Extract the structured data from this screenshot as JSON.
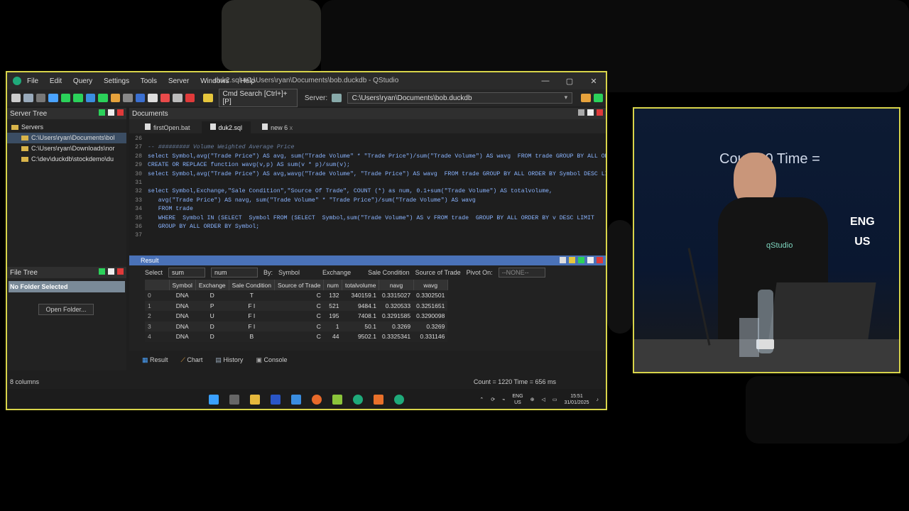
{
  "window": {
    "title": "duk2.sql #C:\\Users\\ryan\\Documents\\bob.duckdb - QStudio",
    "menu": [
      "File",
      "Edit",
      "Query",
      "Settings",
      "Tools",
      "Server",
      "Windows",
      "Help"
    ],
    "min": "—",
    "max": "▢",
    "close": "✕"
  },
  "toolbar": {
    "cmd_search": "Cmd Search [Ctrl+]+[P]",
    "server_label": "Server:",
    "server_value": "C:\\Users\\ryan\\Documents\\bob.duckdb"
  },
  "server_tree": {
    "title": "Server Tree",
    "root": "Servers",
    "items": [
      "C:\\Users\\ryan\\Documents\\bol",
      "C:\\Users\\ryan\\Downloads\\nor",
      "C:\\dev\\duckdb\\stockdemo\\du"
    ]
  },
  "file_tree": {
    "title": "File Tree",
    "no_folder": "No Folder Selected",
    "open_folder": "Open Folder..."
  },
  "documents": {
    "title": "Documents",
    "tabs": [
      "firstOpen.bat",
      "duk2.sql",
      "new 6"
    ],
    "tab_close": "x",
    "lines": [
      {
        "n": "26",
        "t": ""
      },
      {
        "n": "27",
        "t": "-- ######### Volume Weighted Average Price",
        "comment": true
      },
      {
        "n": "28",
        "t": "select Symbol,avg(\"Trade Price\") AS avg, sum(\"Trade Volume\" * \"Trade Price\")/sum(\"Trade Volume\") AS wavg  FROM trade GROUP BY ALL ORDER B"
      },
      {
        "n": "29",
        "t": "CREATE OR REPLACE function wavg(v,p) AS sum(v * p)/sum(v);"
      },
      {
        "n": "30",
        "t": "select Symbol,avg(\"Trade Price\") AS avg,wavg(\"Trade Volume\", \"Trade Price\") AS wavg  FROM trade GROUP BY ALL ORDER BY Symbol DESC LIMI"
      },
      {
        "n": "31",
        "t": ""
      },
      {
        "n": "32",
        "t": "select Symbol,Exchange,\"Sale Condition\",\"Source Of Trade\", COUNT (*) as num, 0.1+sum(\"Trade Volume\") AS totalvolume,"
      },
      {
        "n": "33",
        "t": "   avg(\"Trade Price\") AS navg, sum(\"Trade Volume\" * \"Trade Price\")/sum(\"Trade Volume\") AS wavg"
      },
      {
        "n": "34",
        "t": "   FROM trade"
      },
      {
        "n": "35",
        "t": "   WHERE  Symbol IN (SELECT  Symbol FROM (SELECT  Symbol,sum(\"Trade Volume\") AS v FROM trade  GROUP BY ALL ORDER BY v DESC LIMIT"
      },
      {
        "n": "36",
        "t": "   GROUP BY ALL ORDER BY Symbol;"
      },
      {
        "n": "37",
        "t": ""
      }
    ]
  },
  "result": {
    "title": "Result",
    "pivot": {
      "select_label": "Select",
      "select_value": "sum",
      "num_value": "num",
      "by_label": "By:",
      "symbol": "Symbol",
      "exchange": "Exchange",
      "sale_condition": "Sale Condition",
      "source": "Source of Trade",
      "pivot_on": "Pivot On:",
      "none": "--NONE--"
    },
    "columns": [
      "",
      "Symbol",
      "Exchange",
      "Sale Condition",
      "Source of Trade",
      "num",
      "totalvolume",
      "navg",
      "wavg"
    ],
    "rows": [
      [
        "0",
        "DNA",
        "D",
        "T",
        "C",
        "132",
        "340159.1",
        "0.3315027",
        "0.3302501"
      ],
      [
        "1",
        "DNA",
        "P",
        "F I",
        "C",
        "521",
        "9484.1",
        "0.320533",
        "0.3251651"
      ],
      [
        "2",
        "DNA",
        "U",
        "F I",
        "C",
        "195",
        "7408.1",
        "0.3291585",
        "0.3290098"
      ],
      [
        "3",
        "DNA",
        "D",
        "F I",
        "C",
        "1",
        "50.1",
        "0.3269",
        "0.3269"
      ],
      [
        "4",
        "DNA",
        "D",
        "B",
        "C",
        "44",
        "9502.1",
        "0.3325341",
        "0.331146"
      ]
    ]
  },
  "bottom_tabs": [
    "Result",
    "Chart",
    "History",
    "Console"
  ],
  "status": {
    "columns": "8 columns",
    "summary": "Count = 1220  Time = 656 ms"
  },
  "taskbar": {
    "lang1": "ENG",
    "lang2": "US",
    "time": "15:51",
    "date": "31/01/2025"
  },
  "video": {
    "screen_text": "Cou    220   Time =",
    "eng": "ENG",
    "us": "US",
    "shirt": "qStudio"
  }
}
